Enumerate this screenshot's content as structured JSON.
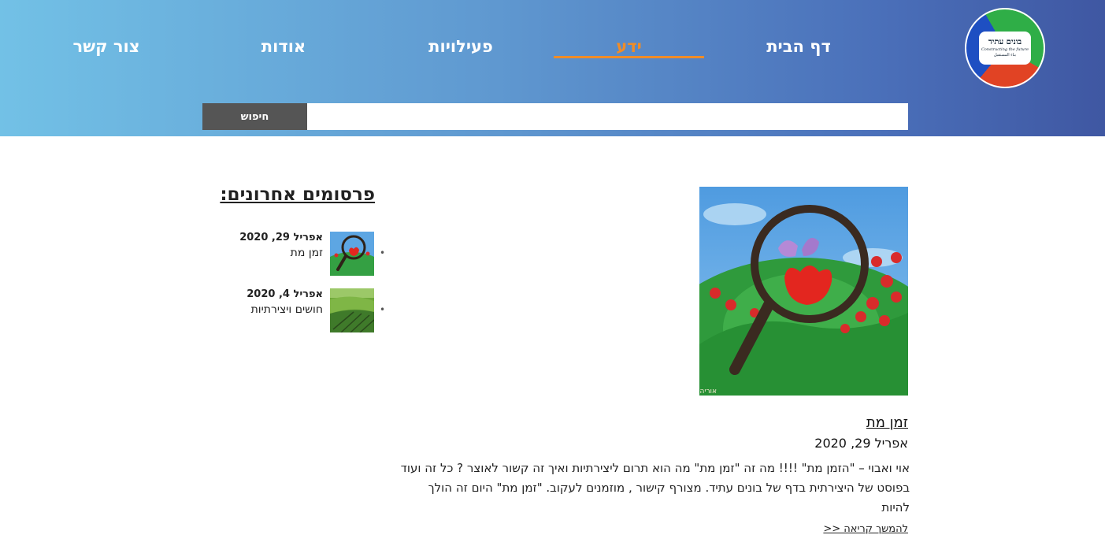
{
  "logo": {
    "title": "בונים עתיד",
    "subtitle": "Constructing the future",
    "arabic": "بناء المستقبل"
  },
  "nav": {
    "home": "דף הבית",
    "knowledge": "ידע",
    "activities": "פעילויות",
    "about": "אודות",
    "contact": "צור קשר",
    "active_color": "#f08c27"
  },
  "search": {
    "button_label": "חיפוש",
    "value": "",
    "placeholder": ""
  },
  "post": {
    "title": "זמן מת",
    "date": "אפריל 29, 2020",
    "excerpt": "אוי ואבוי – \"הזמן מת\" !!!! מה זה \"זמן מת\" מה הוא תרום ליצירתיות ואיך זה קשור לאוצר ? כל זה ועוד בפוסט של היצירתית בדף של בונים עתיד. מצורף קישור , מוזמנים לעקוב. \"זמן מת\" היום זה הולך להיות",
    "read_more": "להמשך קריאה <<"
  },
  "recent": {
    "title": "פרסומים אחרונים:",
    "items": [
      {
        "date": "אפריל 29, 2020",
        "title": "זמן מת"
      },
      {
        "date": "אפריל 4, 2020",
        "title": "חושים ויצירתיות"
      }
    ]
  }
}
